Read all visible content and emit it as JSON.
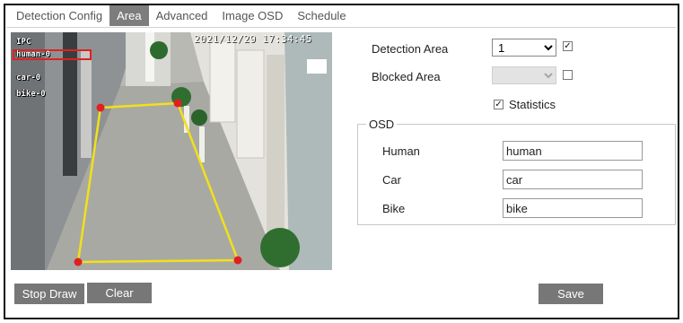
{
  "tabs": [
    {
      "label": "Detection Config"
    },
    {
      "label": "Area"
    },
    {
      "label": "Advanced"
    },
    {
      "label": "Image OSD"
    },
    {
      "label": "Schedule"
    }
  ],
  "active_tab": "Area",
  "video": {
    "timestamp": "2021/12/29 17:34:45",
    "osd_lines": [
      "IPC",
      "human-0",
      "car-0",
      "bike-0"
    ],
    "area_line_color": "#f2e01a",
    "vertex_color": "#e02020"
  },
  "settings": {
    "detection_area_label": "Detection Area",
    "detection_area_value": "1",
    "detection_area_checked": true,
    "blocked_area_label": "Blocked Area",
    "blocked_area_value": "",
    "blocked_area_checked": false,
    "statistics_label": "Statistics",
    "statistics_checked": true
  },
  "osd": {
    "legend": "OSD",
    "fields": [
      {
        "label": "Human",
        "value": "human"
      },
      {
        "label": "Car",
        "value": "car"
      },
      {
        "label": "Bike",
        "value": "bike"
      }
    ]
  },
  "buttons": {
    "stop_draw": "Stop Draw",
    "clear": "Clear",
    "save": "Save"
  },
  "icons": {
    "checked": "check-icon",
    "dropdown": "chevron-down-icon"
  }
}
